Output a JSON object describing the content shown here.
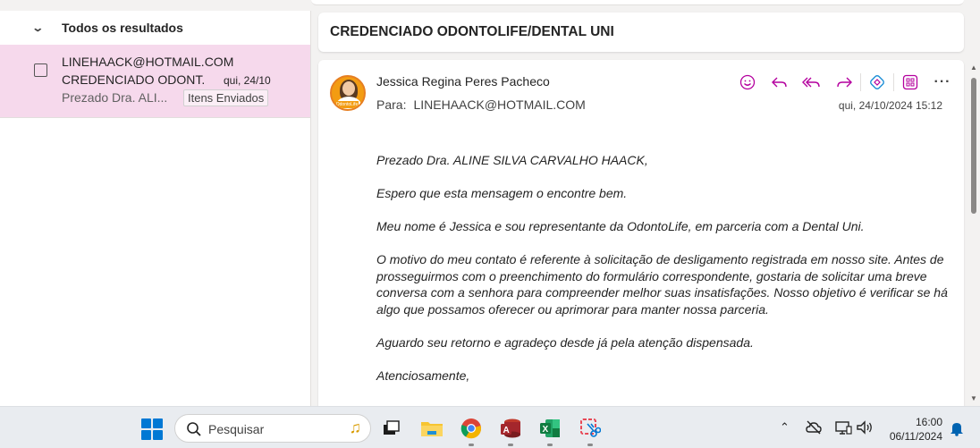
{
  "list": {
    "group_label": "Todos os resultados",
    "items": [
      {
        "sender": "LINEHAACK@HOTMAIL.COM",
        "subject": "CREDENCIADO ODONT...",
        "date": "qui, 24/10",
        "preview": "Prezado Dra. ALI...",
        "folder": "Itens Enviados"
      }
    ]
  },
  "message": {
    "subject": "CREDENCIADO ODONTOLIFE/DENTAL UNI",
    "from": "Jessica Regina Peres Pacheco",
    "to_label": "Para:",
    "to": "LINEHAACK@HOTMAIL.COM",
    "sent": "qui, 24/10/2024 15:12",
    "avatar_badge": "OdontoLife",
    "body": [
      "Prezado Dra.  ALINE SILVA CARVALHO HAACK,",
      "Espero que esta mensagem o encontre bem.",
      "Meu nome é Jessica e sou representante da OdontoLife, em parceria com a Dental Uni.",
      "O motivo do meu contato é referente à solicitação de desligamento registrada em nosso site. Antes de prosseguirmos com o preenchimento do formulário correspondente, gostaria de solicitar uma breve conversa com a senhora para compreender melhor suas insatisfações. Nosso objetivo é verificar se há algo que possamos oferecer ou aprimorar para manter nossa parceria.",
      "Aguardo seu retorno e agradeço desde já pela atenção dispensada.",
      "Atenciosamente,"
    ],
    "actions": [
      "emoji-reaction-icon",
      "reply-icon",
      "reply-all-icon",
      "forward-icon",
      "loop-icon",
      "apps-icon",
      "more-icon"
    ]
  },
  "taskbar": {
    "search_placeholder": "Pesquisar",
    "time": "16:00",
    "date": "06/11/2024",
    "apps": [
      "task-view-icon",
      "file-explorer-icon",
      "chrome-icon",
      "access-icon",
      "excel-icon",
      "snipping-tool-icon"
    ]
  },
  "colors": {
    "accent": "#b4009e",
    "selected_item": "#f6d9ec",
    "windows_blue": "#0078d4"
  }
}
